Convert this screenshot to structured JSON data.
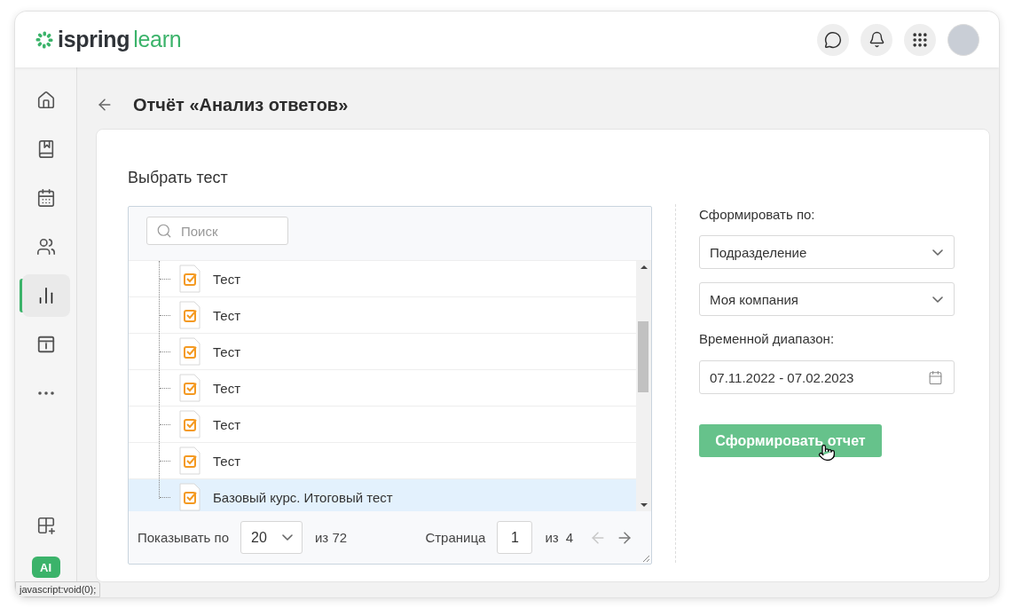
{
  "header": {
    "logo_word_1": "ispring",
    "logo_word_2": "learn"
  },
  "sidebar": {
    "items": [
      {
        "kind": "home",
        "selected": false
      },
      {
        "kind": "courses",
        "selected": false
      },
      {
        "kind": "calendar",
        "selected": false
      },
      {
        "kind": "users",
        "selected": false
      },
      {
        "kind": "reports",
        "selected": true
      },
      {
        "kind": "info",
        "selected": false
      },
      {
        "kind": "more",
        "selected": false
      }
    ],
    "bottom_items": [
      {
        "kind": "apps",
        "selected": false
      }
    ],
    "avatar": "AI"
  },
  "page": {
    "title": "Отчёт «Анализ ответов»"
  },
  "selector": {
    "heading": "Выбрать тест",
    "search": {
      "placeholder": "Поиск"
    },
    "rows": [
      {
        "label": "Тест",
        "selected": false
      },
      {
        "label": "Тест",
        "selected": false
      },
      {
        "label": "Тест",
        "selected": false
      },
      {
        "label": "Тест",
        "selected": false
      },
      {
        "label": "Тест",
        "selected": false
      },
      {
        "label": "Тест",
        "selected": false
      },
      {
        "label": "Базовый курс. Итоговый тест",
        "selected": true
      }
    ],
    "pagination": {
      "show_label": "Показывать по",
      "page_size": "20",
      "total": "из 72",
      "page_label": "Страница",
      "page": "1",
      "page_total_prefix": "из",
      "page_total": "4",
      "prev_disabled": true,
      "next_disabled": false
    }
  },
  "form": {
    "group_by_label": "Сформировать по:",
    "group_by": "Подразделение",
    "unit": "Моя компания",
    "range_label": "Временной диапазон:",
    "range": "07.11.2022 - 07.02.2023",
    "submit": "Сформировать отчет"
  },
  "status_bar": {
    "url": "javascript:void(0);"
  }
}
